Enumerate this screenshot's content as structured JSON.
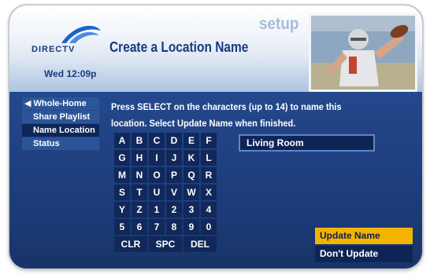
{
  "brand": {
    "logo_text": "DIRECTV"
  },
  "header": {
    "section": "setup",
    "title": "Create a Location Name",
    "clock": "Wed 12:09p"
  },
  "sidebar": {
    "items": [
      {
        "label": "Whole-Home",
        "arrow": "◀"
      },
      {
        "label": "Share Playlist"
      },
      {
        "label": "Name Location"
      },
      {
        "label": "Status"
      }
    ]
  },
  "main": {
    "instructions_line1": "Press SELECT on the characters (up to 14) to name this",
    "instructions_line2": "location. Select Update Name when finished.",
    "name_value": "Living Room",
    "keys": [
      [
        "A",
        "B",
        "C",
        "D",
        "E",
        "F"
      ],
      [
        "G",
        "H",
        "I",
        "J",
        "K",
        "L"
      ],
      [
        "M",
        "N",
        "O",
        "P",
        "Q",
        "R"
      ],
      [
        "S",
        "T",
        "U",
        "V",
        "W",
        "X"
      ],
      [
        "Y",
        "Z",
        "1",
        "2",
        "3",
        "4"
      ],
      [
        "5",
        "6",
        "7",
        "8",
        "9",
        "0"
      ]
    ],
    "special_keys": {
      "clr": "CLR",
      "spc": "SPC",
      "del": "DEL"
    },
    "update_button": "Update Name",
    "dont_update_button": "Don't Update"
  },
  "colors": {
    "accent": "#f2b400",
    "panel": "#1d3c7a",
    "key": "#12285a"
  }
}
